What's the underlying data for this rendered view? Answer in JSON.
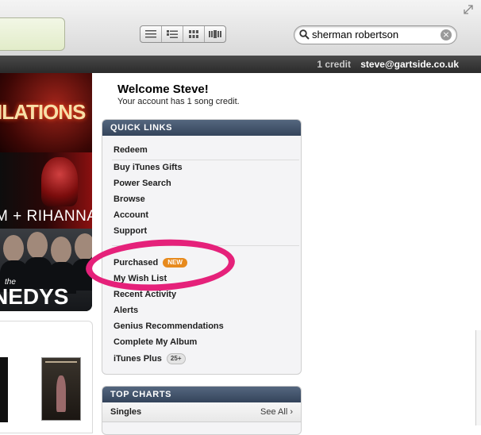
{
  "toolbar": {
    "view_buttons": [
      {
        "icon": "list-view-icon"
      },
      {
        "icon": "album-list-view-icon"
      },
      {
        "icon": "grid-view-icon"
      },
      {
        "icon": "coverflow-view-icon"
      }
    ],
    "search": {
      "value": "sherman robertson",
      "icon": "search-icon",
      "clear_icon": "clear-icon",
      "clear_glyph": "×"
    },
    "resize_icon": "fullscreen-icon"
  },
  "account_bar": {
    "credit": "1 credit",
    "email": "steve@gartside.co.uk"
  },
  "banners": [
    {
      "text": "ILATIONS"
    },
    {
      "text": "M + RIHANNA"
    },
    {
      "text": "NEDYS",
      "small": "the"
    }
  ],
  "welcome": {
    "title": "Welcome Steve!",
    "subtitle": "Your account has 1 song credit."
  },
  "quick_links": {
    "header": "QUICK LINKS",
    "items": [
      {
        "label": "Redeem"
      },
      {
        "label": "Buy iTunes Gifts"
      },
      {
        "label": "Power Search"
      },
      {
        "label": "Browse"
      },
      {
        "label": "Account"
      },
      {
        "label": "Support"
      },
      {
        "label": "Purchased",
        "badge": "NEW"
      },
      {
        "label": "My Wish List"
      },
      {
        "label": "Recent Activity"
      },
      {
        "label": "Alerts"
      },
      {
        "label": "Genius Recommendations"
      },
      {
        "label": "Complete My Album"
      },
      {
        "label": "iTunes Plus",
        "badge": "25+"
      }
    ]
  },
  "top_charts": {
    "header": "TOP CHARTS",
    "row_label": "Singles",
    "see_all": "See All ›"
  },
  "colors": {
    "highlight": "#e5217a",
    "new_badge": "#e78a1d",
    "panel_header": "#34445b"
  }
}
